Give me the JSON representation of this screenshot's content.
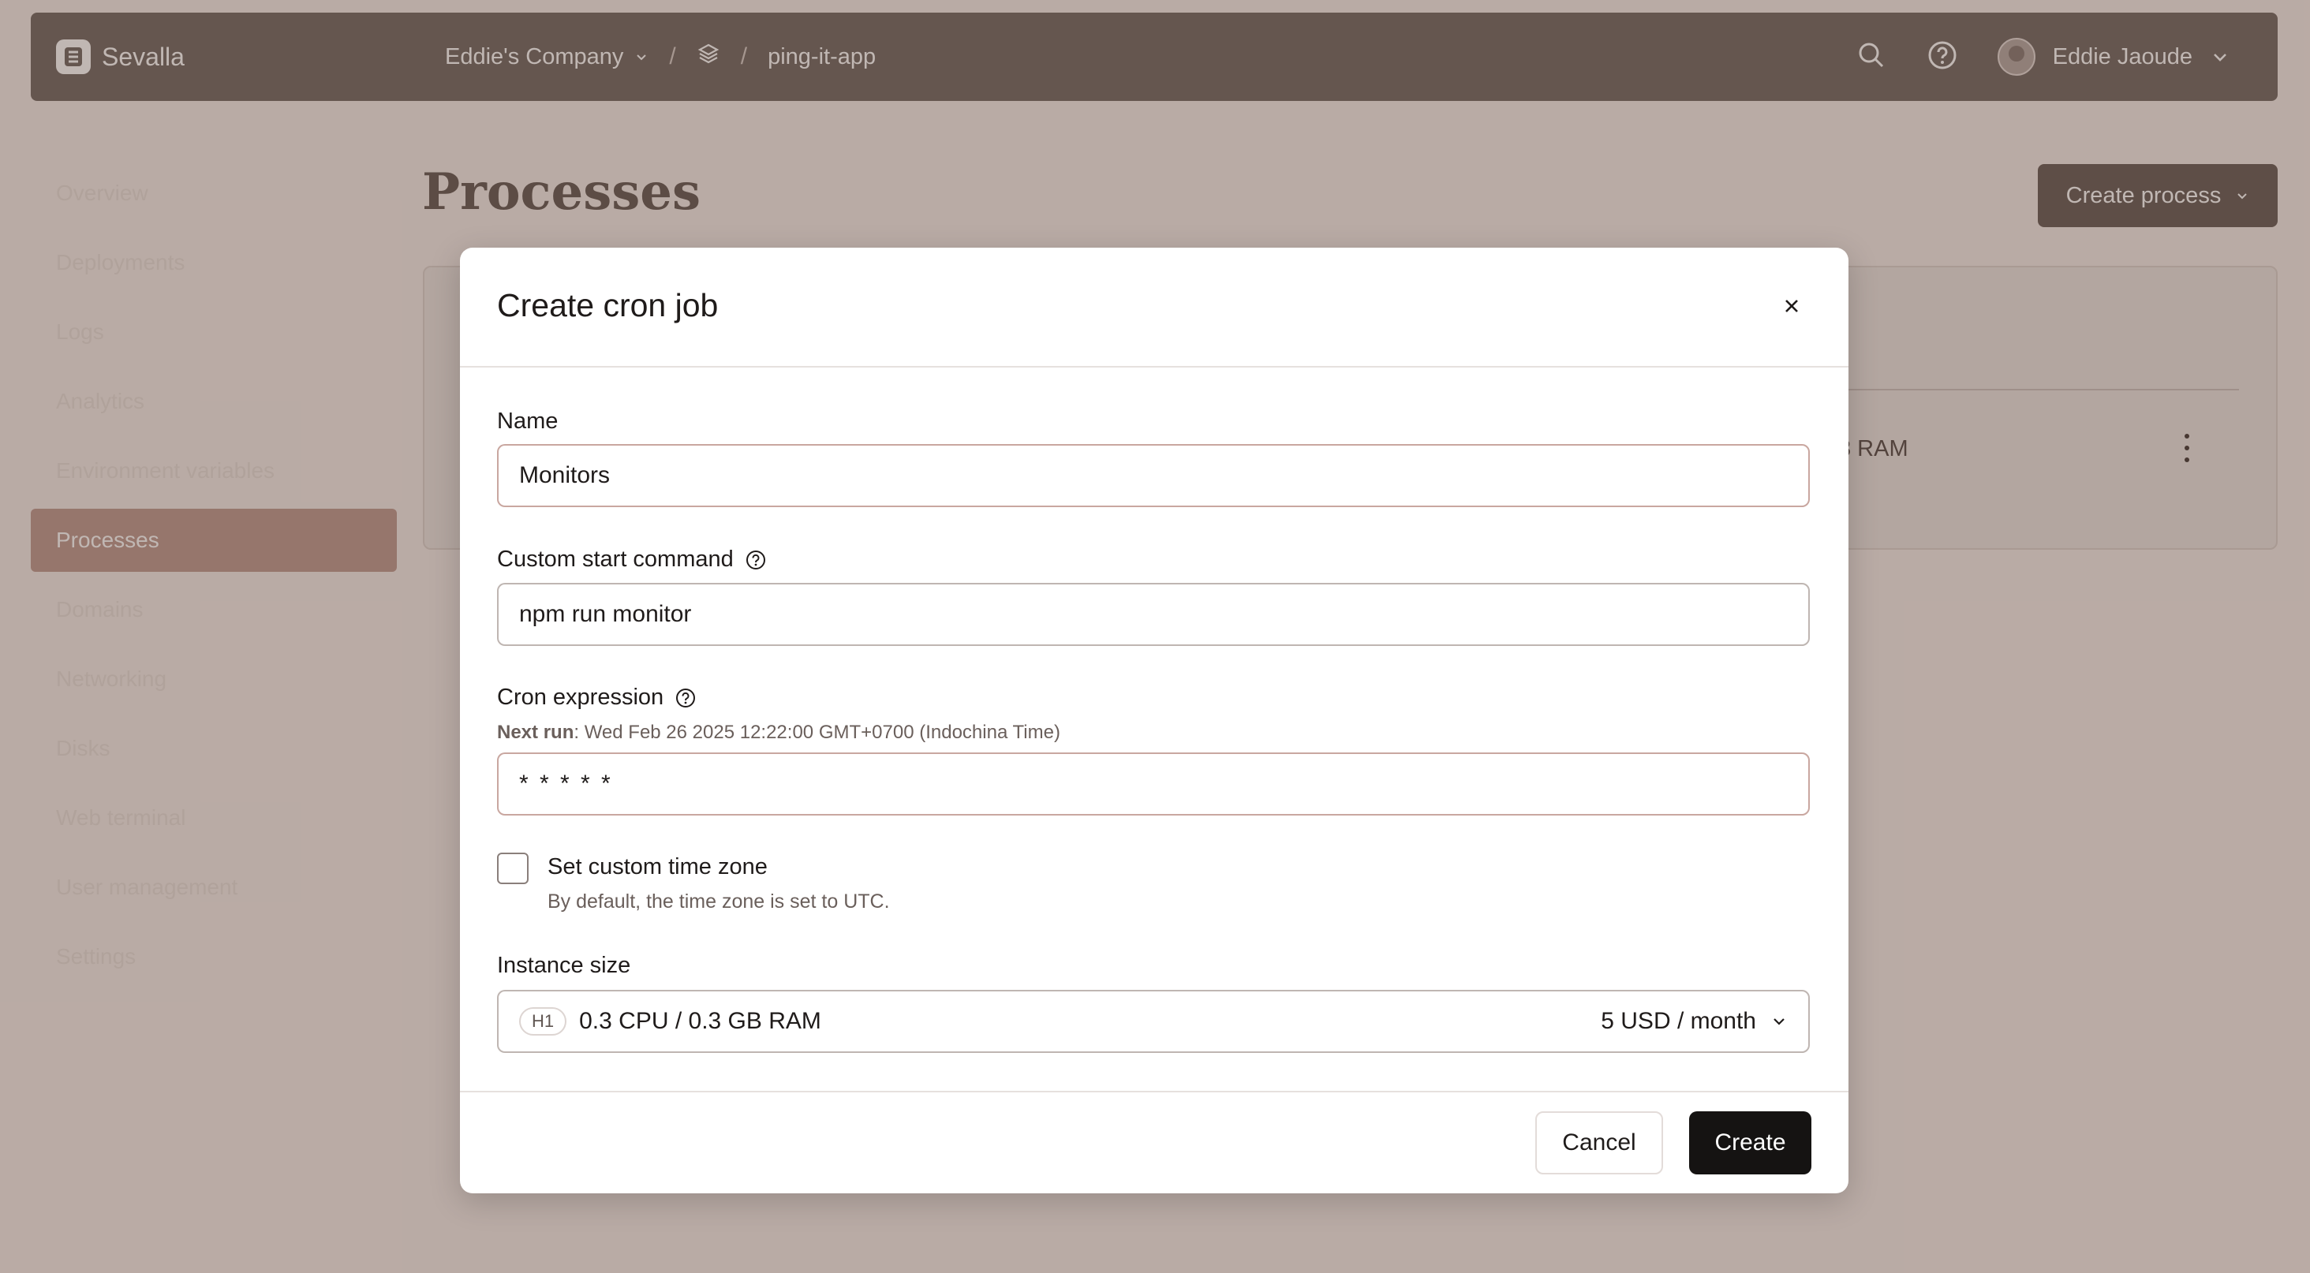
{
  "app": {
    "name": "Sevalla"
  },
  "header": {
    "company": "Eddie's Company",
    "separator": "/",
    "app_name": "ping-it-app",
    "user_name": "Eddie Jaoude"
  },
  "sidebar": {
    "items": [
      {
        "label": "Overview"
      },
      {
        "label": "Deployments"
      },
      {
        "label": "Logs"
      },
      {
        "label": "Analytics"
      },
      {
        "label": "Environment variables"
      },
      {
        "label": "Processes",
        "active": true
      },
      {
        "label": "Domains"
      },
      {
        "label": "Networking"
      },
      {
        "label": "Disks"
      },
      {
        "label": "Web terminal"
      },
      {
        "label": "User management"
      },
      {
        "label": "Settings"
      }
    ]
  },
  "main": {
    "title": "Processes",
    "create_button": "Create process",
    "card_partial_text": "3 RAM"
  },
  "modal": {
    "title": "Create cron job",
    "name": {
      "label": "Name",
      "value": "Monitors"
    },
    "command": {
      "label": "Custom start command",
      "value": "npm run monitor"
    },
    "cron": {
      "label": "Cron expression",
      "next_run_label": "Next run",
      "next_run_value": ": Wed Feb 26 2025 12:22:00 GMT+0700 (Indochina Time)",
      "value": "* * * * *"
    },
    "timezone": {
      "label": "Set custom time zone",
      "hint": "By default, the time zone is set to UTC.",
      "checked": false
    },
    "instance": {
      "label": "Instance size",
      "tier": "H1",
      "spec": "0.3 CPU / 0.3 GB RAM",
      "price": "5 USD / month"
    },
    "cancel_label": "Cancel",
    "create_label": "Create"
  },
  "colors": {
    "topbar": "#7a706c",
    "primary_button": "#151312",
    "active_nav": "#c29f97",
    "overlay": "rgba(60,30,20,0.32)"
  }
}
